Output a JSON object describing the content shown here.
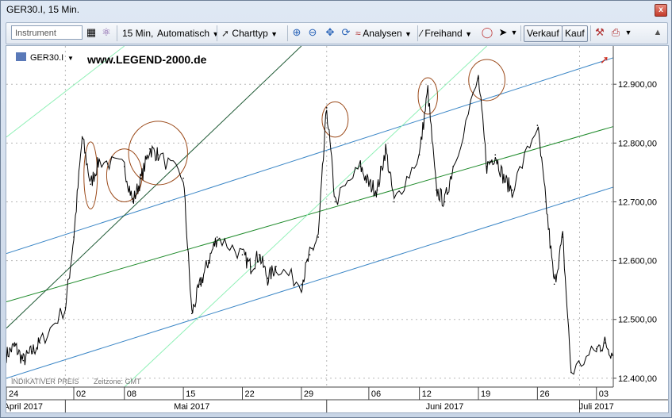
{
  "window": {
    "title": "GER30.I, 15 Min.",
    "close_glyph": "x"
  },
  "toolbar": {
    "instrument_placeholder": "Instrument",
    "interval_label": "15 Min,",
    "mode_label": "Automatisch",
    "charttype_label": "Charttyp",
    "analyses_label": "Analysen",
    "freehand_label": "Freihand",
    "sell_label": "Verkauf",
    "buy_label": "Kauf"
  },
  "chart": {
    "symbol": "GER30.I",
    "watermark": "www.LEGEND-2000.de",
    "footer_note": "INDIKATIVER PREIS",
    "timezone_note": "Zeitzone: GMT",
    "y_ticks": [
      12900,
      12800,
      12700,
      12600,
      12500,
      12400
    ],
    "y_tick_labels": [
      "12.900,00",
      "12.800,00",
      "12.700,00",
      "12.600,00",
      "12.500,00",
      "12.400,00"
    ],
    "x_day_labels": [
      "24",
      "02",
      "08",
      "15",
      "22",
      "29",
      "06",
      "12",
      "19",
      "26",
      "03"
    ],
    "x_month_labels": [
      "April 2017",
      "Mai 2017",
      "Juni 2017",
      "Juli 2017"
    ],
    "colors": {
      "price": "#000000",
      "channel_blue": "#3b86c6",
      "trend_green": "#1e8a2a",
      "trend_dark": "#1f5a35",
      "trend_light": "#8ff0b6",
      "ellipse": "#9b4a1a",
      "grid": "#b8b8b8"
    }
  },
  "chart_data": {
    "type": "line",
    "title": "GER30.I",
    "subtitle": "15 Min.",
    "xlabel": "",
    "ylabel": "",
    "ylim": [
      12385,
      12965
    ],
    "x_range": [
      "2017-04-24",
      "2017-07-05"
    ],
    "series": [
      {
        "name": "GER30.I",
        "x": [
          "2017-04-24",
          "2017-04-25",
          "2017-04-26",
          "2017-04-27",
          "2017-04-28",
          "2017-05-01",
          "2017-05-02",
          "2017-05-03",
          "2017-05-04",
          "2017-05-05",
          "2017-05-08",
          "2017-05-09",
          "2017-05-10",
          "2017-05-11",
          "2017-05-12",
          "2017-05-15",
          "2017-05-16",
          "2017-05-17",
          "2017-05-18",
          "2017-05-19",
          "2017-05-22",
          "2017-05-23",
          "2017-05-24",
          "2017-05-25",
          "2017-05-26",
          "2017-05-29",
          "2017-05-30",
          "2017-05-31",
          "2017-06-01",
          "2017-06-02",
          "2017-06-05",
          "2017-06-06",
          "2017-06-07",
          "2017-06-08",
          "2017-06-09",
          "2017-06-12",
          "2017-06-13",
          "2017-06-14",
          "2017-06-15",
          "2017-06-16",
          "2017-06-19",
          "2017-06-20",
          "2017-06-21",
          "2017-06-22",
          "2017-06-23",
          "2017-06-26",
          "2017-06-27",
          "2017-06-28",
          "2017-06-29",
          "2017-06-30",
          "2017-07-03",
          "2017-07-04",
          "2017-07-05"
        ],
        "y": [
          12440,
          12455,
          12430,
          12445,
          12460,
          12520,
          12640,
          12810,
          12730,
          12770,
          12760,
          12700,
          12740,
          12790,
          12780,
          12740,
          12510,
          12560,
          12600,
          12640,
          12610,
          12590,
          12610,
          12570,
          12590,
          12560,
          12610,
          12640,
          12860,
          12700,
          12760,
          12730,
          12720,
          12790,
          12700,
          12780,
          12890,
          12720,
          12700,
          12760,
          12910,
          12760,
          12780,
          12740,
          12720,
          12830,
          12700,
          12560,
          12640,
          12410,
          12450,
          12460,
          12440
        ]
      }
    ],
    "overlays": [
      {
        "type": "trendline",
        "color": "channel_blue",
        "from": [
          "2017-04-24",
          12612
        ],
        "to": [
          "2017-07-05",
          12945
        ]
      },
      {
        "type": "trendline",
        "color": "channel_blue",
        "from": [
          "2017-04-24",
          12400
        ],
        "to": [
          "2017-07-05",
          12725
        ]
      },
      {
        "type": "trendline",
        "color": "trend_green",
        "from": [
          "2017-04-24",
          12530
        ],
        "to": [
          "2017-07-05",
          12828
        ]
      },
      {
        "type": "trendline",
        "color": "trend_dark",
        "from": [
          "2017-04-24",
          12485
        ],
        "to": [
          "2017-05-29",
          12965
        ]
      },
      {
        "type": "trendline",
        "color": "trend_light",
        "from": [
          "2017-04-24",
          12810
        ],
        "to": [
          "2017-05-08",
          12965
        ]
      },
      {
        "type": "trendline",
        "color": "trend_light",
        "from": [
          "2017-05-08",
          12385
        ],
        "to": [
          "2017-06-20",
          12965
        ]
      },
      {
        "type": "ellipse",
        "color": "ellipse",
        "center": [
          "2017-05-04",
          12745
        ],
        "span_days": 1.6,
        "span_points": 114
      },
      {
        "type": "ellipse",
        "color": "ellipse",
        "center": [
          "2017-05-08",
          12745
        ],
        "span_days": 4.2,
        "span_points": 90
      },
      {
        "type": "ellipse",
        "color": "ellipse",
        "center": [
          "2017-05-12",
          12783
        ],
        "span_days": 7.0,
        "span_points": 108
      },
      {
        "type": "ellipse",
        "color": "ellipse",
        "center": [
          "2017-06-02",
          12840
        ],
        "span_days": 3.1,
        "span_points": 60
      },
      {
        "type": "ellipse",
        "color": "ellipse",
        "center": [
          "2017-06-13",
          12880
        ],
        "span_days": 2.3,
        "span_points": 62
      },
      {
        "type": "ellipse",
        "color": "ellipse",
        "center": [
          "2017-06-20",
          12907
        ],
        "span_days": 4.3,
        "span_points": 70
      }
    ],
    "grid": true,
    "legend": "none"
  }
}
